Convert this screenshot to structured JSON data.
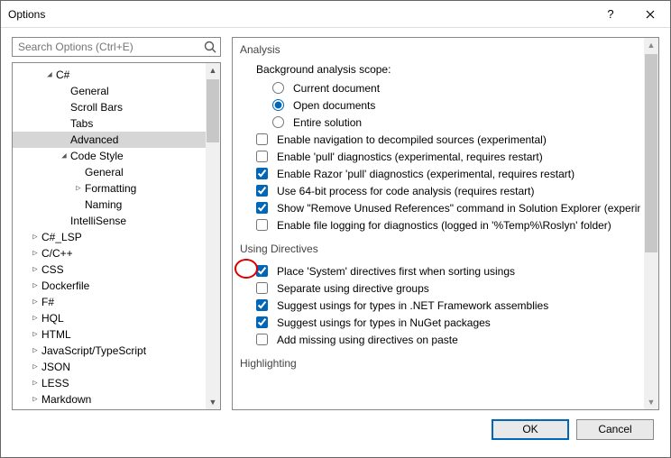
{
  "window": {
    "title": "Options"
  },
  "search": {
    "placeholder": "Search Options (Ctrl+E)"
  },
  "tree": [
    {
      "label": "C#",
      "indent": 1,
      "exp": "down"
    },
    {
      "label": "General",
      "indent": 2,
      "exp": ""
    },
    {
      "label": "Scroll Bars",
      "indent": 2,
      "exp": ""
    },
    {
      "label": "Tabs",
      "indent": 2,
      "exp": ""
    },
    {
      "label": "Advanced",
      "indent": 2,
      "exp": "",
      "selected": true
    },
    {
      "label": "Code Style",
      "indent": 2,
      "exp": "down"
    },
    {
      "label": "General",
      "indent": 3,
      "exp": ""
    },
    {
      "label": "Formatting",
      "indent": 3,
      "exp": "right"
    },
    {
      "label": "Naming",
      "indent": 3,
      "exp": ""
    },
    {
      "label": "IntelliSense",
      "indent": 2,
      "exp": ""
    },
    {
      "label": "C#_LSP",
      "indent": 0,
      "exp": "right"
    },
    {
      "label": "C/C++",
      "indent": 0,
      "exp": "right"
    },
    {
      "label": "CSS",
      "indent": 0,
      "exp": "right"
    },
    {
      "label": "Dockerfile",
      "indent": 0,
      "exp": "right"
    },
    {
      "label": "F#",
      "indent": 0,
      "exp": "right"
    },
    {
      "label": "HQL",
      "indent": 0,
      "exp": "right"
    },
    {
      "label": "HTML",
      "indent": 0,
      "exp": "right"
    },
    {
      "label": "JavaScript/TypeScript",
      "indent": 0,
      "exp": "right"
    },
    {
      "label": "JSON",
      "indent": 0,
      "exp": "right"
    },
    {
      "label": "LESS",
      "indent": 0,
      "exp": "right"
    },
    {
      "label": "Markdown",
      "indent": 0,
      "exp": "right"
    }
  ],
  "sections": {
    "analysis": {
      "heading": "Analysis",
      "scopeLabel": "Background analysis scope:",
      "radios": [
        {
          "label": "Current document",
          "checked": false
        },
        {
          "label": "Open documents",
          "checked": true
        },
        {
          "label": "Entire solution",
          "checked": false
        }
      ],
      "checks": [
        {
          "label": "Enable navigation to decompiled sources (experimental)",
          "checked": false
        },
        {
          "label": "Enable 'pull' diagnostics (experimental, requires restart)",
          "checked": false
        },
        {
          "label": "Enable Razor 'pull' diagnostics (experimental, requires restart)",
          "checked": true
        },
        {
          "label": "Use 64-bit process for code analysis (requires restart)",
          "checked": true
        },
        {
          "label": "Show \"Remove Unused References\" command in Solution Explorer (experim",
          "checked": true
        },
        {
          "label": "Enable file logging for diagnostics (logged in '%Temp%\\Roslyn' folder)",
          "checked": false
        }
      ]
    },
    "using": {
      "heading": "Using Directives",
      "checks": [
        {
          "label": "Place 'System' directives first when sorting usings",
          "checked": true
        },
        {
          "label": "Separate using directive groups",
          "checked": false
        },
        {
          "label": "Suggest usings for types in .NET Framework assemblies",
          "checked": true
        },
        {
          "label": "Suggest usings for types in NuGet packages",
          "checked": true
        },
        {
          "label": "Add missing using directives on paste",
          "checked": false
        }
      ]
    },
    "highlighting": {
      "heading": "Highlighting"
    }
  },
  "footer": {
    "ok": "OK",
    "cancel": "Cancel"
  }
}
